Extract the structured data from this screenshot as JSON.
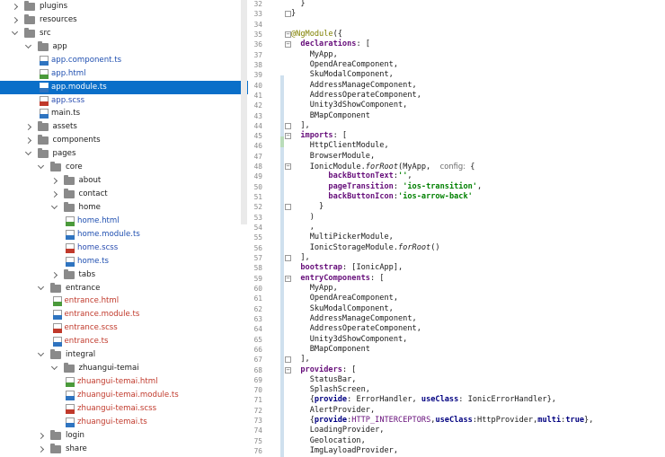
{
  "project_tree": {
    "items": [
      {
        "label": "plugins",
        "type": "folder",
        "depth": 0,
        "state": "closed"
      },
      {
        "label": "resources",
        "type": "folder",
        "depth": 0,
        "state": "closed"
      },
      {
        "label": "src",
        "type": "folder",
        "depth": 0,
        "state": "open"
      },
      {
        "label": "app",
        "type": "folder",
        "depth": 1,
        "state": "open"
      },
      {
        "label": "app.component.ts",
        "type": "ts",
        "depth": 2
      },
      {
        "label": "app.html",
        "type": "html",
        "depth": 2
      },
      {
        "label": "app.module.ts",
        "type": "ts",
        "depth": 2,
        "selected": true
      },
      {
        "label": "app.scss",
        "type": "scss",
        "depth": 2
      },
      {
        "label": "main.ts",
        "type": "ts-plain",
        "depth": 2
      },
      {
        "label": "assets",
        "type": "folder",
        "depth": 1,
        "state": "closed"
      },
      {
        "label": "components",
        "type": "folder",
        "depth": 1,
        "state": "closed"
      },
      {
        "label": "pages",
        "type": "folder",
        "depth": 1,
        "state": "open"
      },
      {
        "label": "core",
        "type": "folder",
        "depth": 2,
        "state": "open"
      },
      {
        "label": "about",
        "type": "folder",
        "depth": 3,
        "state": "closed"
      },
      {
        "label": "contact",
        "type": "folder",
        "depth": 3,
        "state": "closed"
      },
      {
        "label": "home",
        "type": "folder",
        "depth": 3,
        "state": "open"
      },
      {
        "label": "home.html",
        "type": "html",
        "depth": 4
      },
      {
        "label": "home.module.ts",
        "type": "ts",
        "depth": 4
      },
      {
        "label": "home.scss",
        "type": "scss",
        "depth": 4
      },
      {
        "label": "home.ts",
        "type": "ts",
        "depth": 4
      },
      {
        "label": "tabs",
        "type": "folder",
        "depth": 3,
        "state": "closed"
      },
      {
        "label": "entrance",
        "type": "folder",
        "depth": 2,
        "state": "open"
      },
      {
        "label": "entrance.html",
        "type": "html-red",
        "depth": 3
      },
      {
        "label": "entrance.module.ts",
        "type": "ts-red",
        "depth": 3
      },
      {
        "label": "entrance.scss",
        "type": "scss-red",
        "depth": 3
      },
      {
        "label": "entrance.ts",
        "type": "ts-red",
        "depth": 3
      },
      {
        "label": "integral",
        "type": "folder",
        "depth": 2,
        "state": "open"
      },
      {
        "label": "zhuangui-temai",
        "type": "folder",
        "depth": 3,
        "state": "open"
      },
      {
        "label": "zhuangui-temai.html",
        "type": "html-red",
        "depth": 4
      },
      {
        "label": "zhuangui-temai.module.ts",
        "type": "ts-red",
        "depth": 4
      },
      {
        "label": "zhuangui-temai.scss",
        "type": "scss-red",
        "depth": 4
      },
      {
        "label": "zhuangui-temai.ts",
        "type": "ts-red",
        "depth": 4
      },
      {
        "label": "login",
        "type": "folder",
        "depth": 2,
        "state": "closed"
      },
      {
        "label": "share",
        "type": "folder",
        "depth": 2,
        "state": "closed"
      }
    ]
  },
  "editor": {
    "lines": [
      {
        "n": "32",
        "fold": "",
        "tokens": [
          {
            "t": "  }",
            "c": ""
          }
        ]
      },
      {
        "n": "33",
        "fold": "end",
        "tokens": [
          {
            "t": "}",
            "c": ""
          }
        ]
      },
      {
        "n": "34",
        "fold": "",
        "tokens": []
      },
      {
        "n": "35",
        "fold": "start",
        "tokens": [
          {
            "t": "@NgModule",
            "c": "anno"
          },
          {
            "t": "({",
            "c": ""
          }
        ]
      },
      {
        "n": "36",
        "fold": "start",
        "tokens": [
          {
            "t": "  ",
            "c": ""
          },
          {
            "t": "declarations",
            "c": "prop"
          },
          {
            "t": ": [",
            "c": ""
          }
        ]
      },
      {
        "n": "37",
        "fold": "",
        "tokens": [
          {
            "t": "    MyApp,",
            "c": ""
          }
        ]
      },
      {
        "n": "38",
        "fold": "",
        "tokens": [
          {
            "t": "    OpendAreaComponent,",
            "c": ""
          }
        ]
      },
      {
        "n": "39",
        "fold": "",
        "tokens": [
          {
            "t": "    SkuModalComponent,",
            "c": ""
          }
        ]
      },
      {
        "n": "40",
        "fold": "",
        "tokens": [
          {
            "t": "    AddressManageComponent,",
            "c": ""
          }
        ]
      },
      {
        "n": "41",
        "fold": "",
        "tokens": [
          {
            "t": "    AddressOperateComponent,",
            "c": ""
          }
        ]
      },
      {
        "n": "42",
        "fold": "",
        "tokens": [
          {
            "t": "    Unity3dShowComponent,",
            "c": ""
          }
        ]
      },
      {
        "n": "43",
        "fold": "",
        "tokens": [
          {
            "t": "    BMapComponent",
            "c": ""
          }
        ]
      },
      {
        "n": "44",
        "fold": "end",
        "tokens": [
          {
            "t": "  ],",
            "c": ""
          }
        ]
      },
      {
        "n": "45",
        "fold": "start",
        "tokens": [
          {
            "t": "  ",
            "c": ""
          },
          {
            "t": "imports",
            "c": "prop"
          },
          {
            "t": ": [",
            "c": ""
          }
        ]
      },
      {
        "n": "46",
        "fold": "",
        "tokens": [
          {
            "t": "    HttpClientModule,",
            "c": ""
          }
        ]
      },
      {
        "n": "47",
        "fold": "",
        "tokens": [
          {
            "t": "    BrowserModule,",
            "c": ""
          }
        ]
      },
      {
        "n": "48",
        "fold": "start",
        "tokens": [
          {
            "t": "    IonicModule.",
            "c": ""
          },
          {
            "t": "forRoot",
            "c": "fn"
          },
          {
            "t": "(MyApp,  ",
            "c": ""
          },
          {
            "t": "config:",
            "c": "hint"
          },
          {
            "t": " {",
            "c": ""
          }
        ]
      },
      {
        "n": "49",
        "fold": "",
        "tokens": [
          {
            "t": "        ",
            "c": ""
          },
          {
            "t": "backButtonText",
            "c": "prop"
          },
          {
            "t": ":",
            "c": ""
          },
          {
            "t": "''",
            "c": "str"
          },
          {
            "t": ",",
            "c": ""
          }
        ]
      },
      {
        "n": "50",
        "fold": "",
        "tokens": [
          {
            "t": "        ",
            "c": ""
          },
          {
            "t": "pageTransition",
            "c": "prop"
          },
          {
            "t": ": ",
            "c": ""
          },
          {
            "t": "'ios-transition'",
            "c": "str"
          },
          {
            "t": ",",
            "c": ""
          }
        ]
      },
      {
        "n": "51",
        "fold": "",
        "tokens": [
          {
            "t": "        ",
            "c": ""
          },
          {
            "t": "backButtonIcon",
            "c": "prop"
          },
          {
            "t": ":",
            "c": ""
          },
          {
            "t": "'ios-arrow-back'",
            "c": "str"
          }
        ]
      },
      {
        "n": "52",
        "fold": "end",
        "tokens": [
          {
            "t": "      }",
            "c": ""
          }
        ]
      },
      {
        "n": "53",
        "fold": "",
        "tokens": [
          {
            "t": "    )",
            "c": ""
          }
        ]
      },
      {
        "n": "54",
        "fold": "",
        "tokens": [
          {
            "t": "    ,",
            "c": ""
          }
        ]
      },
      {
        "n": "55",
        "fold": "",
        "tokens": [
          {
            "t": "    MultiPickerModule,",
            "c": ""
          }
        ]
      },
      {
        "n": "56",
        "fold": "",
        "tokens": [
          {
            "t": "    IonicStorageModule.",
            "c": ""
          },
          {
            "t": "forRoot",
            "c": "fn"
          },
          {
            "t": "()",
            "c": ""
          }
        ]
      },
      {
        "n": "57",
        "fold": "end",
        "tokens": [
          {
            "t": "  ],",
            "c": ""
          }
        ]
      },
      {
        "n": "58",
        "fold": "",
        "tokens": [
          {
            "t": "  ",
            "c": ""
          },
          {
            "t": "bootstrap",
            "c": "prop"
          },
          {
            "t": ": [IonicApp],",
            "c": ""
          }
        ]
      },
      {
        "n": "59",
        "fold": "start",
        "tokens": [
          {
            "t": "  ",
            "c": ""
          },
          {
            "t": "entryComponents",
            "c": "prop"
          },
          {
            "t": ": [",
            "c": ""
          }
        ]
      },
      {
        "n": "60",
        "fold": "",
        "tokens": [
          {
            "t": "    MyApp,",
            "c": ""
          }
        ]
      },
      {
        "n": "61",
        "fold": "",
        "tokens": [
          {
            "t": "    OpendAreaComponent,",
            "c": ""
          }
        ]
      },
      {
        "n": "62",
        "fold": "",
        "tokens": [
          {
            "t": "    SkuModalComponent,",
            "c": ""
          }
        ]
      },
      {
        "n": "63",
        "fold": "",
        "tokens": [
          {
            "t": "    AddressManageComponent,",
            "c": ""
          }
        ]
      },
      {
        "n": "64",
        "fold": "",
        "tokens": [
          {
            "t": "    AddressOperateComponent,",
            "c": ""
          }
        ]
      },
      {
        "n": "65",
        "fold": "",
        "tokens": [
          {
            "t": "    Unity3dShowComponent,",
            "c": ""
          }
        ]
      },
      {
        "n": "66",
        "fold": "",
        "tokens": [
          {
            "t": "    BMapComponent",
            "c": ""
          }
        ]
      },
      {
        "n": "67",
        "fold": "end",
        "tokens": [
          {
            "t": "  ],",
            "c": ""
          }
        ]
      },
      {
        "n": "68",
        "fold": "start",
        "tokens": [
          {
            "t": "  ",
            "c": ""
          },
          {
            "t": "providers",
            "c": "prop"
          },
          {
            "t": ": [",
            "c": ""
          }
        ]
      },
      {
        "n": "69",
        "fold": "",
        "tokens": [
          {
            "t": "    StatusBar,",
            "c": ""
          }
        ]
      },
      {
        "n": "70",
        "fold": "",
        "tokens": [
          {
            "t": "    SplashScreen,",
            "c": ""
          }
        ]
      },
      {
        "n": "71",
        "fold": "",
        "tokens": [
          {
            "t": "    {",
            "c": ""
          },
          {
            "t": "provide",
            "c": "kw"
          },
          {
            "t": ": ErrorHandler, ",
            "c": ""
          },
          {
            "t": "useClass",
            "c": "kw"
          },
          {
            "t": ": IonicErrorHandler},",
            "c": ""
          }
        ]
      },
      {
        "n": "72",
        "fold": "",
        "tokens": [
          {
            "t": "    AlertProvider,",
            "c": ""
          }
        ]
      },
      {
        "n": "73",
        "fold": "",
        "tokens": [
          {
            "t": "    {",
            "c": ""
          },
          {
            "t": "provide",
            "c": "kw"
          },
          {
            "t": ":",
            "c": ""
          },
          {
            "t": "HTTP_INTERCEPTORS",
            "c": "const"
          },
          {
            "t": ",",
            "c": ""
          },
          {
            "t": "useClass",
            "c": "kw"
          },
          {
            "t": ":HttpProvider,",
            "c": ""
          },
          {
            "t": "multi",
            "c": "kw"
          },
          {
            "t": ":",
            "c": ""
          },
          {
            "t": "true",
            "c": "kw"
          },
          {
            "t": "},",
            "c": ""
          }
        ]
      },
      {
        "n": "74",
        "fold": "",
        "tokens": [
          {
            "t": "    LoadingProvider,",
            "c": ""
          }
        ]
      },
      {
        "n": "75",
        "fold": "",
        "tokens": [
          {
            "t": "    Geolocation,",
            "c": ""
          }
        ]
      },
      {
        "n": "76",
        "fold": "",
        "tokens": [
          {
            "t": "    ImgLayloadProvider,",
            "c": ""
          }
        ]
      }
    ]
  }
}
